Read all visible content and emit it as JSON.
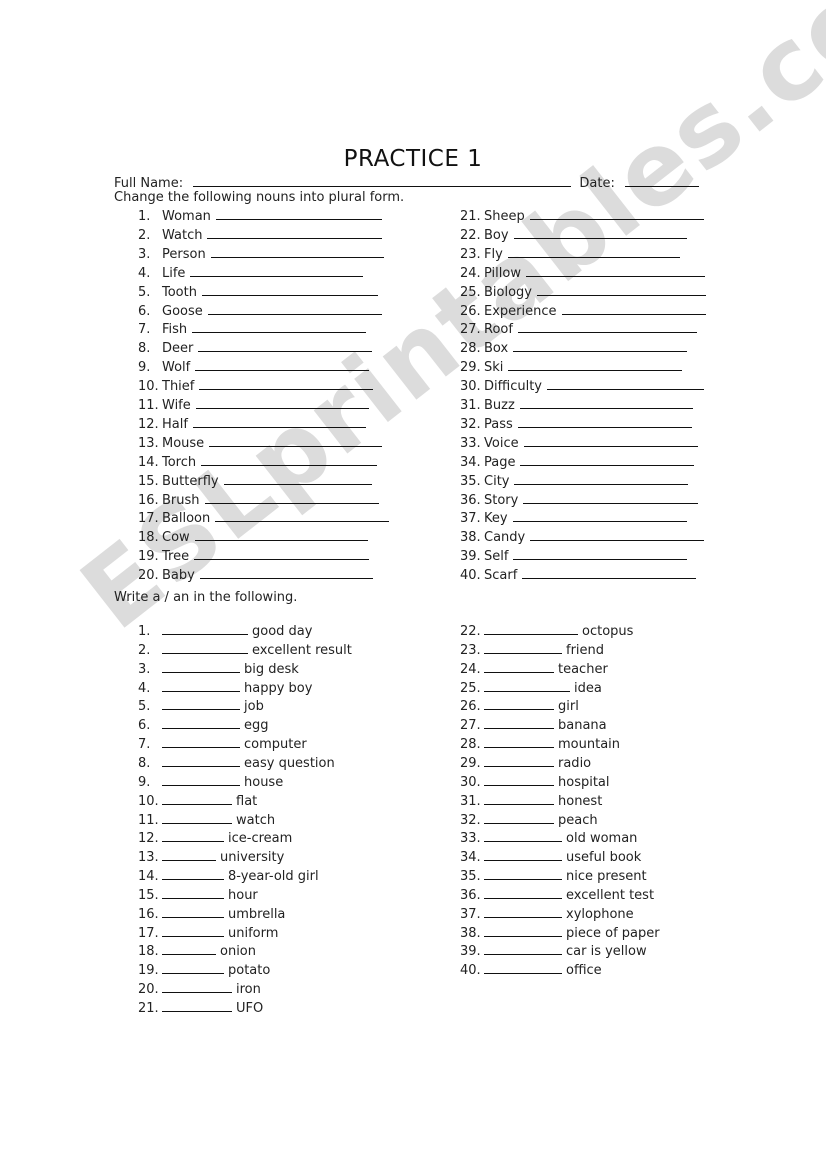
{
  "title": "PRACTICE 1",
  "header": {
    "name_label": "Full Name:",
    "date_label": "Date:"
  },
  "watermark": "ESLprintables.com",
  "section1": {
    "instruction": "Change the following nouns into plural form.",
    "left": [
      {
        "n": "1.",
        "word": "Woman"
      },
      {
        "n": "2.",
        "word": "Watch"
      },
      {
        "n": "3.",
        "word": "Person"
      },
      {
        "n": "4.",
        "word": "Life"
      },
      {
        "n": "5.",
        "word": "Tooth"
      },
      {
        "n": "6.",
        "word": "Goose"
      },
      {
        "n": "7.",
        "word": "Fish"
      },
      {
        "n": "8.",
        "word": "Deer"
      },
      {
        "n": "9.",
        "word": "Wolf"
      },
      {
        "n": "10.",
        "word": "Thief"
      },
      {
        "n": "11.",
        "word": "Wife"
      },
      {
        "n": "12.",
        "word": "Half"
      },
      {
        "n": "13.",
        "word": "Mouse"
      },
      {
        "n": "14.",
        "word": "Torch"
      },
      {
        "n": "15.",
        "word": "Butterfly"
      },
      {
        "n": "16.",
        "word": "Brush"
      },
      {
        "n": "17.",
        "word": "Balloon"
      },
      {
        "n": "18.",
        "word": "Cow"
      },
      {
        "n": "19.",
        "word": "Tree"
      },
      {
        "n": "20.",
        "word": "Baby"
      }
    ],
    "right": [
      {
        "n": "21.",
        "word": "Sheep"
      },
      {
        "n": "22.",
        "word": "Boy"
      },
      {
        "n": "23.",
        "word": "Fly"
      },
      {
        "n": "24.",
        "word": "Pillow"
      },
      {
        "n": "25.",
        "word": "Biology"
      },
      {
        "n": "26.",
        "word": "Experience"
      },
      {
        "n": "27.",
        "word": "Roof"
      },
      {
        "n": "28.",
        "word": "Box"
      },
      {
        "n": "29.",
        "word": "Ski"
      },
      {
        "n": "30.",
        "word": "Difficulty"
      },
      {
        "n": "31.",
        "word": "Buzz"
      },
      {
        "n": "32.",
        "word": "Pass"
      },
      {
        "n": "33.",
        "word": "Voice"
      },
      {
        "n": "34.",
        "word": "Page"
      },
      {
        "n": "35.",
        "word": "City"
      },
      {
        "n": "36.",
        "word": "Story"
      },
      {
        "n": "37.",
        "word": "Key"
      },
      {
        "n": "38.",
        "word": "Candy"
      },
      {
        "n": "39.",
        "word": "Self"
      },
      {
        "n": "40.",
        "word": "Scarf"
      }
    ]
  },
  "section2": {
    "instruction": "Write a / an in the following.",
    "left": [
      {
        "n": "1.",
        "text": "good day"
      },
      {
        "n": "2.",
        "text": "excellent result"
      },
      {
        "n": "3.",
        "text": "big desk"
      },
      {
        "n": "4.",
        "text": "happy boy"
      },
      {
        "n": "5.",
        "text": "job"
      },
      {
        "n": "6.",
        "text": "egg"
      },
      {
        "n": "7.",
        "text": "computer"
      },
      {
        "n": "8.",
        "text": "easy question"
      },
      {
        "n": "9.",
        "text": "house"
      },
      {
        "n": "10.",
        "text": "flat"
      },
      {
        "n": "11.",
        "text": "watch"
      },
      {
        "n": "12.",
        "text": "ice-cream"
      },
      {
        "n": "13.",
        "text": "university"
      },
      {
        "n": "14.",
        "text": "8-year-old girl"
      },
      {
        "n": "15.",
        "text": "hour"
      },
      {
        "n": "16.",
        "text": "umbrella"
      },
      {
        "n": "17.",
        "text": "uniform"
      },
      {
        "n": "18.",
        "text": "onion"
      },
      {
        "n": "19.",
        "text": "potato"
      },
      {
        "n": "20.",
        "text": "iron"
      },
      {
        "n": "21.",
        "text": "UFO"
      }
    ],
    "right": [
      {
        "n": "22.",
        "text": "octopus"
      },
      {
        "n": "23.",
        "text": "friend"
      },
      {
        "n": "24.",
        "text": "teacher"
      },
      {
        "n": "25.",
        "text": "idea"
      },
      {
        "n": "26.",
        "text": "girl"
      },
      {
        "n": "27.",
        "text": "banana"
      },
      {
        "n": "28.",
        "text": "mountain"
      },
      {
        "n": "29.",
        "text": "radio"
      },
      {
        "n": "30.",
        "text": "hospital"
      },
      {
        "n": "31.",
        "text": "honest"
      },
      {
        "n": "32.",
        "text": "peach"
      },
      {
        "n": "33.",
        "text": "old woman"
      },
      {
        "n": "34.",
        "text": "useful book"
      },
      {
        "n": "35.",
        "text": "nice present"
      },
      {
        "n": "36.",
        "text": "excellent test"
      },
      {
        "n": "37.",
        "text": "xylophone"
      },
      {
        "n": "38.",
        "text": "piece of paper"
      },
      {
        "n": "39.",
        "text": "car is yellow"
      },
      {
        "n": "40.",
        "text": "office"
      }
    ]
  }
}
